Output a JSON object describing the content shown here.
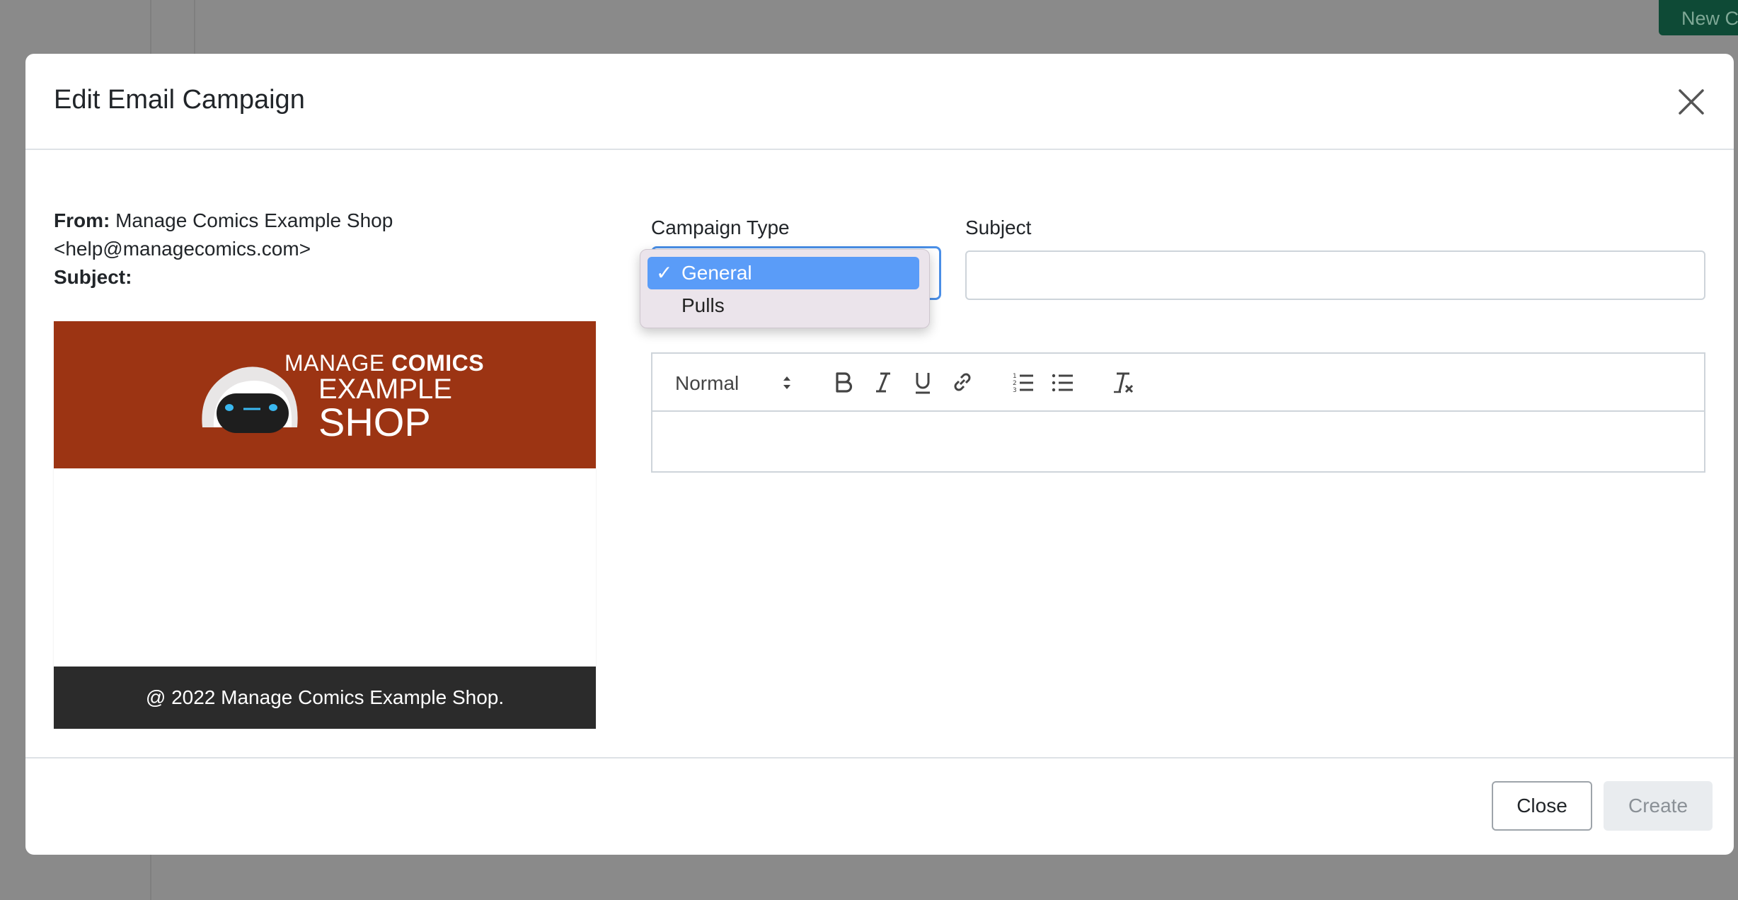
{
  "background": {
    "new_button_label": "New C"
  },
  "modal": {
    "title": "Edit Email Campaign"
  },
  "preview": {
    "from_label": "From:",
    "from_value": "Manage Comics Example Shop <help@managecomics.com>",
    "subject_label": "Subject:",
    "subject_value": "",
    "logo": {
      "line1_light": "MANAGE ",
      "line1_bold": "COMICS",
      "line2": "EXAMPLE",
      "line3": "SHOP"
    },
    "footer_text": "@ 2022 Manage Comics Example Shop."
  },
  "form": {
    "campaign_type_label": "Campaign Type",
    "campaign_type_options": [
      "General",
      "Pulls"
    ],
    "campaign_type_selected": "General",
    "subject_label": "Subject",
    "subject_value": "",
    "editor": {
      "heading_format": "Normal",
      "tools": [
        "bold-icon",
        "italic-icon",
        "underline-icon",
        "link-icon",
        "ordered-list-icon",
        "bullet-list-icon",
        "clear-format-icon"
      ]
    }
  },
  "footer": {
    "close_label": "Close",
    "create_label": "Create"
  },
  "colors": {
    "banner": "#9c3413",
    "footer_bar": "#2b2b2b",
    "focus": "#4a8fe7",
    "selected_option": "#5a9cf8"
  }
}
